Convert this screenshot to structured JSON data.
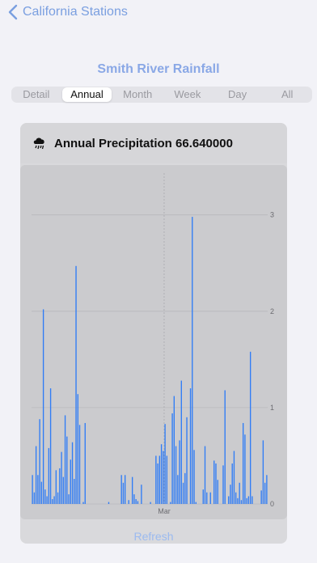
{
  "nav": {
    "back_label": "California Stations"
  },
  "page": {
    "title": "Smith River Rainfall"
  },
  "tabs": [
    {
      "label": "Detail",
      "active": false
    },
    {
      "label": "Annual",
      "active": true
    },
    {
      "label": "Month",
      "active": false
    },
    {
      "label": "Week",
      "active": false
    },
    {
      "label": "Day",
      "active": false
    },
    {
      "label": "All",
      "active": false
    }
  ],
  "card": {
    "icon": "cloud-rain-icon",
    "title": "Annual Precipitation 66.640000",
    "refresh_label": "Refresh"
  },
  "colors": {
    "accent": "#7a9fe0",
    "bar": "#2f7cf6",
    "grid": "#b8b8bc"
  },
  "chart_data": {
    "type": "bar",
    "x_tick_labels": [
      "Mar"
    ],
    "y_ticks": [
      "0",
      "1",
      "2",
      "3"
    ],
    "ylim": [
      0,
      3.35
    ],
    "grid": true,
    "values": [
      0.3,
      0.12,
      0.6,
      0.3,
      0.88,
      0.23,
      2.02,
      0.15,
      0.08,
      0.58,
      1.2,
      0.05,
      0.08,
      0.35,
      0.12,
      0.37,
      0.54,
      0.28,
      0.92,
      0.7,
      0.1,
      0.46,
      0.64,
      0.26,
      2.47,
      1.14,
      0.82,
      0.0,
      0.02,
      0.84,
      0.0,
      0.0,
      0.0,
      0.0,
      0.0,
      0.0,
      0.0,
      0.0,
      0.0,
      0.0,
      0.0,
      0.0,
      0.02,
      0.0,
      0.0,
      0.0,
      0.0,
      0.0,
      0.0,
      0.3,
      0.22,
      0.3,
      0.0,
      0.04,
      0.0,
      0.28,
      0.1,
      0.05,
      0.03,
      0.0,
      0.2,
      0.0,
      0.0,
      0.0,
      0.0,
      0.02,
      0.0,
      0.0,
      0.5,
      0.42,
      0.5,
      0.62,
      0.55,
      0.83,
      0.5,
      0.0,
      0.02,
      0.94,
      1.12,
      0.6,
      0.3,
      0.66,
      1.28,
      0.22,
      0.32,
      0.9,
      0.0,
      1.2,
      2.98,
      0.56,
      0.02,
      0.0,
      0.0,
      0.0,
      0.15,
      0.6,
      0.12,
      0.0,
      0.12,
      0.0,
      0.45,
      0.42,
      0.25,
      0.0,
      0.0,
      0.4,
      1.18,
      0.0,
      0.08,
      0.2,
      0.42,
      0.55,
      0.12,
      0.06,
      0.22,
      0.04,
      0.84,
      0.72,
      0.06,
      0.08,
      1.58,
      0.08,
      0.0,
      0.0,
      0.0,
      0.0,
      0.14,
      0.66,
      0.22,
      0.3
    ]
  }
}
